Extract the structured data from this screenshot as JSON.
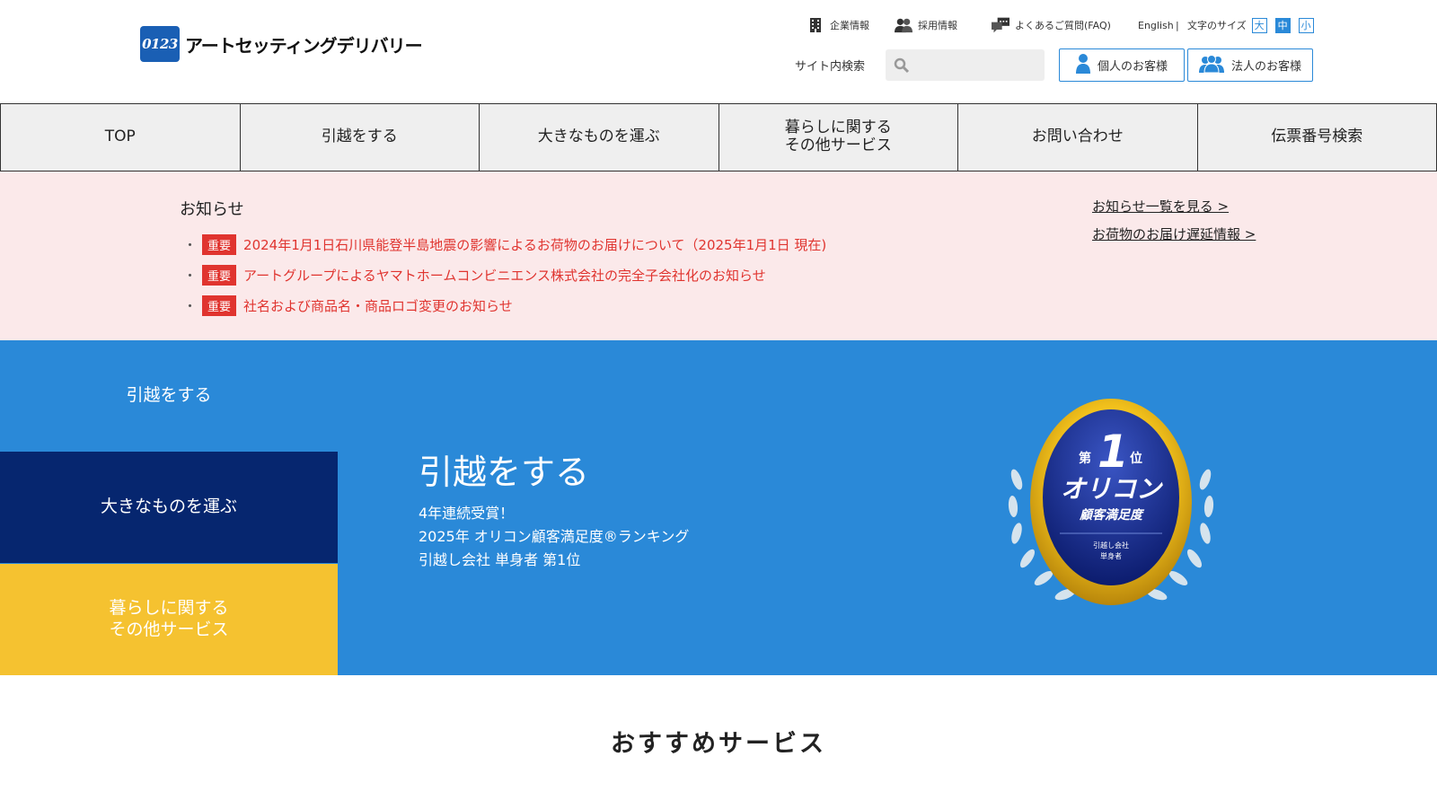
{
  "logo": {
    "badge": "0123",
    "name": "アートセッティングデリバリー"
  },
  "utility": {
    "company": "企業情報",
    "recruit": "採用情報",
    "faq": "よくあるご質問(FAQ)",
    "english": "English",
    "separator": "|",
    "font_size_label": "文字のサイズ",
    "sizes": [
      "大",
      "中",
      "小"
    ]
  },
  "search": {
    "label": "サイト内検索",
    "value": ""
  },
  "customer_buttons": {
    "personal": "個人のお客様",
    "corporate": "法人のお客様"
  },
  "gnav": [
    "TOP",
    "引越をする",
    "大きなものを運ぶ",
    "暮らしに関する\nその他サービス",
    "お問い合わせ",
    "伝票番号検索"
  ],
  "news": {
    "title": "お知らせ",
    "badge": "重要",
    "items": [
      "2024年1月1日石川県能登半島地震の影響によるお荷物のお届けについて（2025年1月1日 現在)",
      "アートグループによるヤマトホームコンビニエンス株式会社の完全子会社化のお知らせ",
      "社名および商品名・商品ロゴ変更のお知らせ"
    ],
    "links": [
      "お知らせ一覧を見る >",
      "お荷物のお届け遅延情報 >"
    ]
  },
  "hero": {
    "tabs": [
      "引越をする",
      "大きなものを運ぶ",
      "暮らしに関する\nその他サービス"
    ],
    "title": "引越をする",
    "desc": [
      "4年連続受賞！",
      "2025年 オリコン顧客満足度®ランキング",
      "引越し会社 単身者 第1位"
    ],
    "medal": {
      "rank_prefix": "第",
      "rank": "1",
      "rank_suffix": "位",
      "brand": "オリコン",
      "sub": "顧客満足度",
      "cat1": "引越し会社",
      "cat2": "単身者"
    }
  },
  "recommended": {
    "title": "おすすめサービス"
  },
  "colors": {
    "primary": "#2a89d8",
    "navy": "#06266f",
    "yellow": "#f5c230",
    "alert": "#e0342f",
    "news_bg": "#fbe9ea"
  }
}
